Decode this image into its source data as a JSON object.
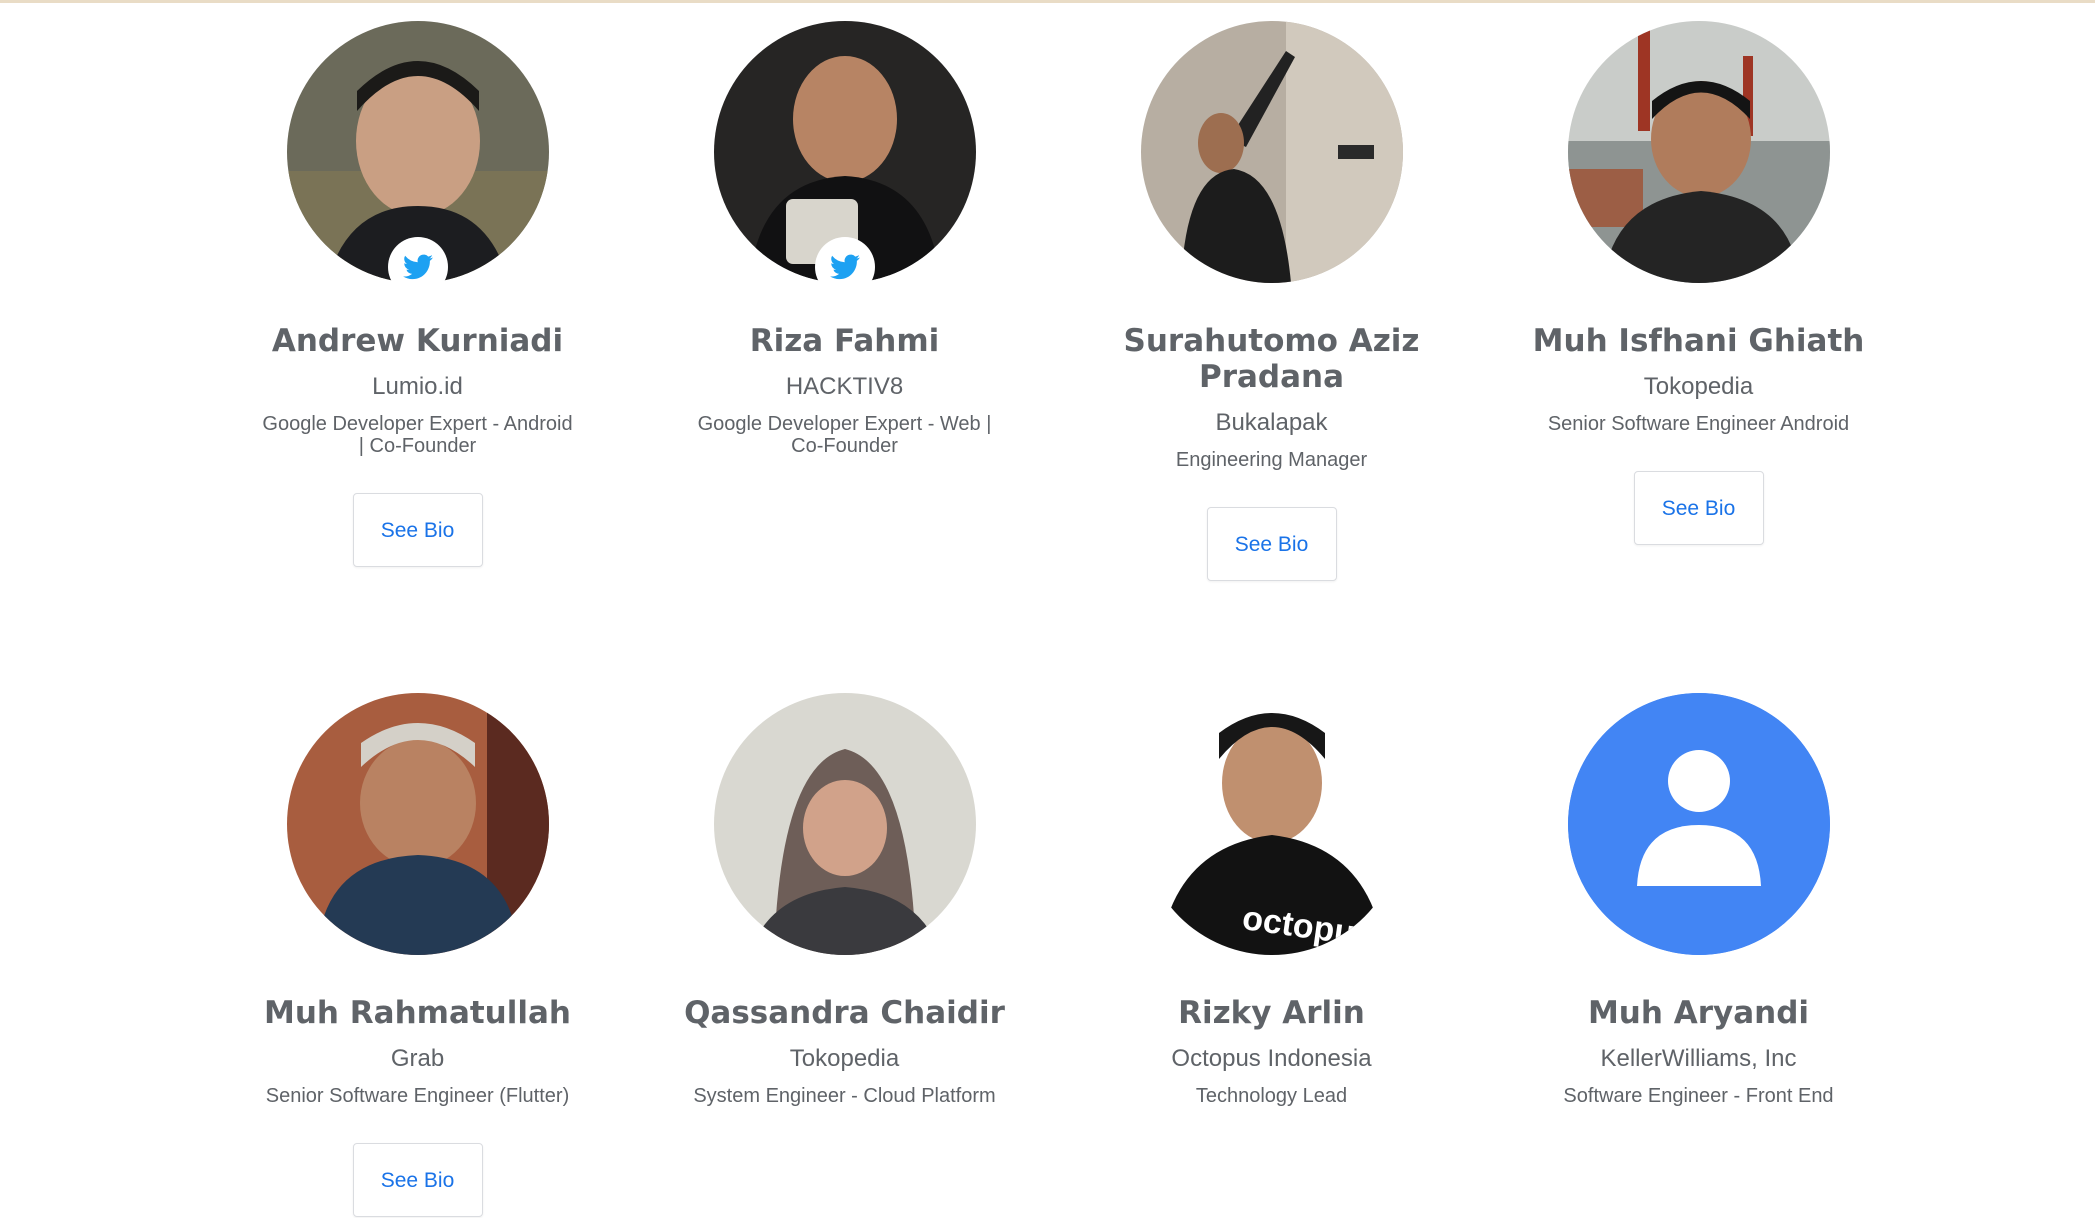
{
  "speakers": [
    {
      "name": "Andrew Kurniadi",
      "company": "Lumio.id",
      "role": "Google Developer Expert - Android | Co-Founder",
      "bio_label": "See Bio",
      "twitter_icon": "twitter-icon",
      "photo": "portrait"
    },
    {
      "name": "Riza Fahmi",
      "company": "HACKTIV8",
      "role": "Google Developer Expert - Web | Co-Founder",
      "bio_label": "",
      "twitter_icon": "twitter-icon",
      "photo": "portrait"
    },
    {
      "name": "Surahutomo Aziz Pradana",
      "company": "Bukalapak",
      "role": "Engineering Manager",
      "bio_label": "See Bio",
      "twitter_icon": "",
      "photo": "portrait"
    },
    {
      "name": "Muh Isfhani Ghiath",
      "company": "Tokopedia",
      "role": "Senior Software Engineer Android",
      "bio_label": "See Bio",
      "twitter_icon": "",
      "photo": "portrait"
    },
    {
      "name": "Muh Rahmatullah",
      "company": "Grab",
      "role": "Senior Software Engineer (Flutter)",
      "bio_label": "See Bio",
      "twitter_icon": "",
      "photo": "portrait"
    },
    {
      "name": "Qassandra Chaidir",
      "company": "Tokopedia",
      "role": "System Engineer - Cloud Platform",
      "bio_label": "",
      "twitter_icon": "",
      "photo": "portrait"
    },
    {
      "name": "Rizky Arlin",
      "company": "Octopus Indonesia",
      "role": "Technology Lead",
      "bio_label": "",
      "twitter_icon": "",
      "photo": "portrait",
      "shirt_text": "octopus"
    },
    {
      "name": "Muh Aryandi",
      "company": "KellerWilliams, Inc",
      "role": "Software Engineer - Front End",
      "bio_label": "",
      "twitter_icon": "",
      "photo": "default-avatar"
    }
  ],
  "colors": {
    "accent": "#1a73e8",
    "text": "#5f6368",
    "avatar_blue": "#4285f4",
    "twitter": "#1da1f2"
  }
}
